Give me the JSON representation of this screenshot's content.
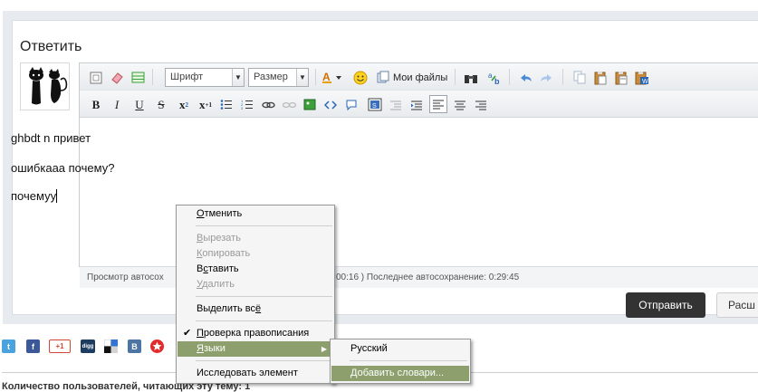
{
  "reply": {
    "title": "Ответить"
  },
  "toolbar": {
    "font_dropdown": "Шрифт",
    "size_dropdown": "Размер",
    "my_files": "Мои файлы",
    "bold": "B",
    "italic": "I",
    "underline": "U",
    "strike": "S",
    "subscript": "x",
    "subscript_sub": "2",
    "superscript": "x",
    "superscript_sup": "+1"
  },
  "editor": {
    "lines": [
      "ghbdt n привет",
      "ошибкааа почему?",
      "почемуу"
    ]
  },
  "autosave": {
    "left_text": "Просмотр автосох",
    "right_text": "00:16 ) Последнее автосохранение: 0:29:45"
  },
  "buttons": {
    "send": "Отправить",
    "extended": "Расш"
  },
  "share": {
    "gplus": "+1",
    "digg": "digg",
    "vk": "B"
  },
  "bottom_text": "Количество пользователей, читающих эту тему: 1",
  "context_menu": {
    "undo": {
      "first": "О",
      "rest": "тменить"
    },
    "cut": {
      "first": "В",
      "rest": "ырезать"
    },
    "copy": {
      "first": "К",
      "rest": "опировать"
    },
    "paste": {
      "first": "В",
      "mid": "с",
      "rest": "тавить"
    },
    "delete": {
      "first": "У",
      "rest": "далить"
    },
    "select_all": {
      "first": "Выделить вс",
      "mid": "ё",
      "rest": ""
    },
    "spellcheck": {
      "first": "П",
      "rest": "роверка правописания"
    },
    "languages": {
      "first": "Я",
      "rest": "зыки"
    },
    "inspect": {
      "first": "Исследовать элемент"
    }
  },
  "submenu": {
    "russian": "Русский",
    "add_dict": {
      "first": "Д",
      "rest": "обавить словари..."
    }
  },
  "colors": {
    "highlight": "#8c9f6d",
    "send_button": "#333333"
  }
}
